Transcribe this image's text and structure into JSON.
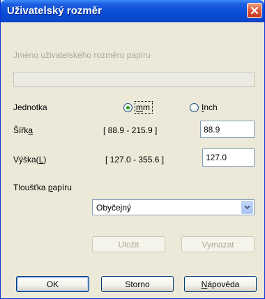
{
  "window": {
    "title": "Uživatelský rozměr"
  },
  "name_field": {
    "label": "Jméno uživatelského rozměru papíru",
    "value": ""
  },
  "unit": {
    "label": "Jednotka",
    "options": [
      {
        "pre": "",
        "key": "m",
        "post": "m",
        "selected": true
      },
      {
        "pre": "",
        "key": "I",
        "post": "nch",
        "selected": false
      }
    ]
  },
  "width": {
    "label_pre": "Šířk",
    "label_key": "a",
    "label_post": "",
    "range": "[ 88.9 - 215.9 ]",
    "value": "88.9"
  },
  "height": {
    "label_pre": "Výška(",
    "label_key": "L",
    "label_post": ")",
    "range": "[ 127.0 - 355.6 ]",
    "value": "127.0"
  },
  "thickness": {
    "label_pre": "Tloušťka ",
    "label_key": "p",
    "label_post": "apíru",
    "selected": "Obyčejný"
  },
  "actions": {
    "save": "Uložit",
    "delete": "Vymazat"
  },
  "footer": {
    "ok": "OK",
    "cancel": "Storno",
    "help_pre": "",
    "help_key": "N",
    "help_post": "ápověda"
  },
  "colors": {
    "titlebar": "#0a4ed8",
    "dialog_bg": "#ece9d8",
    "close_button": "#d8553a",
    "radio_selected": "#21a121"
  }
}
